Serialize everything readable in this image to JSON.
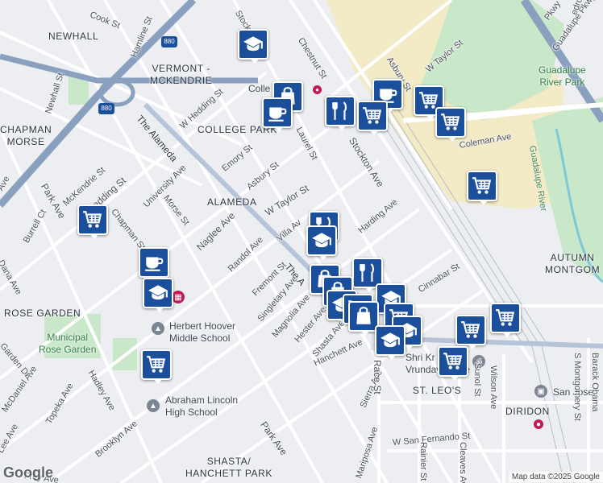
{
  "map": {
    "attribution": "Map data ©2025 Google",
    "logo": "Google",
    "highway_shield": "880"
  },
  "areas": [
    {
      "id": "newhall",
      "lines": [
        "NEWHALL"
      ]
    },
    {
      "id": "vermont",
      "lines": [
        "VERMONT -",
        "MCKENDRIE"
      ]
    },
    {
      "id": "college-park",
      "lines": [
        "COLLEGE PARK"
      ]
    },
    {
      "id": "chapman",
      "lines": [
        "CHAPMAN",
        "MORSE"
      ]
    },
    {
      "id": "alameda",
      "lines": [
        "ALAMEDA"
      ]
    },
    {
      "id": "rose-garden",
      "lines": [
        "ROSE GARDEN"
      ]
    },
    {
      "id": "autumn",
      "lines": [
        "AUTUMN",
        "MONTGOM"
      ]
    },
    {
      "id": "st-leos",
      "lines": [
        "ST. LEO'S"
      ]
    },
    {
      "id": "diridon",
      "lines": [
        "DIRIDON"
      ]
    },
    {
      "id": "shasta",
      "lines": [
        "SHASTA/",
        "HANCHETT PARK"
      ]
    }
  ],
  "places": [
    {
      "id": "hoover",
      "lines": [
        "Herbert Hoover",
        "Middle School"
      ]
    },
    {
      "id": "lincoln",
      "lines": [
        "Abraham Lincoln",
        "High School"
      ]
    },
    {
      "id": "shri",
      "lines": [
        "Shri Kr",
        "Vrundavana Te"
      ]
    },
    {
      "id": "college-park-station",
      "lines": [
        "Colle     ark"
      ]
    },
    {
      "id": "san-jose",
      "lines": [
        "San Jose"
      ]
    }
  ],
  "parks": [
    {
      "id": "guadalupe",
      "lines": [
        "Guadalupe",
        "River Park"
      ]
    },
    {
      "id": "rose",
      "lines": [
        "Municipal",
        "Rose Garden"
      ]
    }
  ],
  "streets": {
    "cook": "Cook St",
    "hamline": "Hamline St",
    "newhall": "Newhall St",
    "stockton_top": "Stockton",
    "chestnut": "Chestnut St",
    "asbury_top": "Asbury St",
    "w_taylor_top": "W Taylor St",
    "coleman": "Coleman Ave",
    "guadalupe_pkwy": "Guadalupe Pkwy",
    "pkwy": "Pkwy",
    "pedro": "edro St",
    "w_hedding_top": "W Hedding St",
    "the_alameda": "The Alameda",
    "laurel": "Laurel St",
    "emory": "Emory St",
    "asbury": "Asbury St",
    "w_taylor": "W Taylor St",
    "stockton_ave": "Stockton Ave",
    "harding": "Harding Ave",
    "villa": "Villa Av",
    "mckendrie": "McKendrie St",
    "hedding": "Hedding St",
    "university": "University Ave",
    "morse": "Morse St",
    "chapman": "Chapman St",
    "park_left": "Park Ave",
    "naglee": "Naglee Ave",
    "randol": "Randol Ave",
    "fremont": "Fremont St",
    "singletary": "Singletary Ave",
    "the_alameda_lower": "The A",
    "magnolia": "Magnolia Ave",
    "hester": "Hester Ave",
    "shasta": "Shasta Ave",
    "hanchett": "Hanchett Ave",
    "cinnabar": "Cinnabar St",
    "sierra": "Sierra Ave",
    "race": "Race St",
    "sunol": "Sunol St",
    "wilson": "Wilson Ave",
    "montgomery": "S Montgomery St",
    "barack": "Barack Obama",
    "w_san_fernando": "W San Fernando St",
    "rainier": "Rainier St",
    "cleaves": "Cleaves Ave",
    "mariposa": "Mariposa Ave",
    "park_ave": "Park Ave",
    "park_ave_bottom": "Park Ave",
    "brooklyn": "Brooklyn Ave",
    "hadley": "Hadley Ave",
    "topeka": "Topeka Ave",
    "mcdaniel": "McDaniel Ave",
    "garden": "Garden Dr",
    "dana": "Dana Ave",
    "burrell": "Burrell Ct",
    "park_far_left": "Park Ave",
    "lee": "Lee Ave",
    "frey": "Frey Ave",
    "sierra_bottom": "Sierra Ave",
    "park_bottom2": "Park Ave",
    "ave_left": "Ave",
    "guadalupe_river": "Guadalupe River"
  },
  "markers": [
    {
      "id": "school-1",
      "type": "school-icon"
    },
    {
      "id": "shop-1",
      "type": "shopping-bag-icon"
    },
    {
      "id": "coffee-1",
      "type": "coffee-icon"
    },
    {
      "id": "restaurant-1",
      "type": "restaurant-icon"
    },
    {
      "id": "coffee-2",
      "type": "coffee-icon"
    },
    {
      "id": "grocery-1",
      "type": "grocery-cart-icon"
    },
    {
      "id": "grocery-2",
      "type": "grocery-cart-icon"
    },
    {
      "id": "grocery-3",
      "type": "grocery-cart-icon"
    },
    {
      "id": "grocery-4",
      "type": "grocery-cart-icon"
    },
    {
      "id": "grocery-5",
      "type": "grocery-cart-icon"
    },
    {
      "id": "restaurant-2",
      "type": "restaurant-icon"
    },
    {
      "id": "school-2",
      "type": "school-icon"
    },
    {
      "id": "coffee-3",
      "type": "coffee-icon"
    },
    {
      "id": "school-3",
      "type": "school-icon"
    },
    {
      "id": "grocery-6",
      "type": "grocery-cart-icon"
    },
    {
      "id": "restaurant-3",
      "type": "restaurant-icon"
    },
    {
      "id": "cluster-shop",
      "type": "shopping-bag-icon"
    },
    {
      "id": "cluster-school",
      "type": "school-icon"
    },
    {
      "id": "cluster-grocery",
      "type": "grocery-cart-icon"
    },
    {
      "id": "grocery-7",
      "type": "grocery-cart-icon"
    },
    {
      "id": "grocery-8",
      "type": "grocery-cart-icon"
    },
    {
      "id": "grocery-9",
      "type": "grocery-cart-icon"
    },
    {
      "id": "shop-2",
      "type": "shopping-bag-icon"
    },
    {
      "id": "school-4",
      "type": "school-icon"
    }
  ],
  "colors": {
    "marker": "#1b4f9c",
    "highway": "#8aa0bf",
    "park": "#c9e8c9",
    "campus": "#f3eac6",
    "water": "#7ec8d8"
  }
}
